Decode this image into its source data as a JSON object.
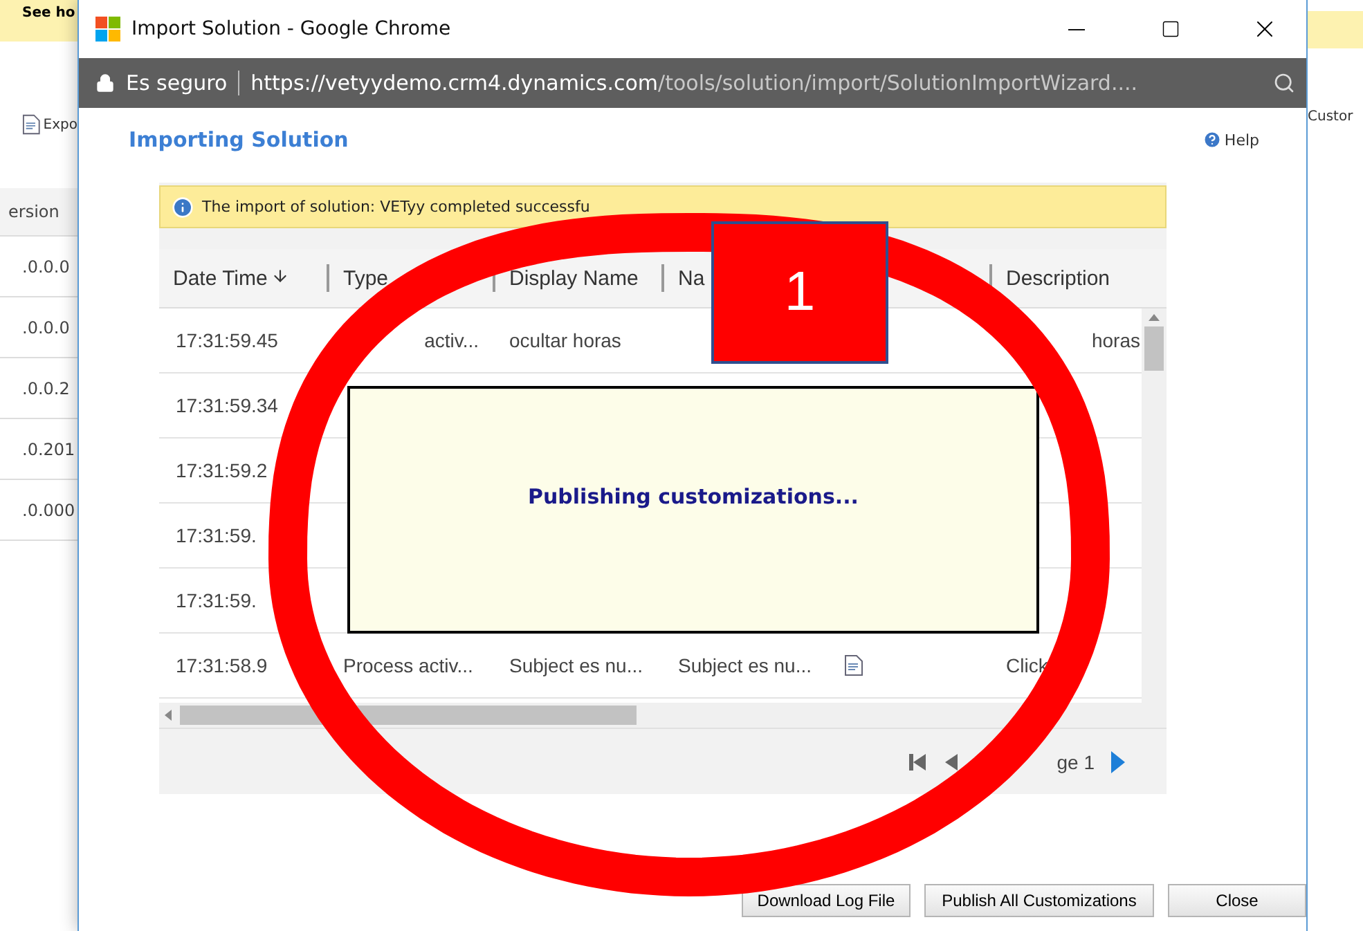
{
  "background": {
    "banner": "See ho",
    "toolbar_left": "Expo",
    "toolbar_right": "Custor",
    "column_header": "ersion",
    "versions": [
      ".0.0.0",
      ".0.0.0",
      ".0.0.2",
      ".0.201",
      ".0.000"
    ]
  },
  "window": {
    "title": "Import Solution - Google Chrome",
    "security": "Es seguro",
    "url_host": "https://vetyydemo.crm4.dynamics.com",
    "url_path": "/tools/solution/import/SolutionImportWizard...."
  },
  "page": {
    "heading": "Importing Solution",
    "help": "Help",
    "notification": "The import of solution: VETyy completed successfu"
  },
  "table": {
    "columns": [
      {
        "label": "Date Time",
        "sorted": true
      },
      {
        "label": "Type",
        "sorted": false
      },
      {
        "label": "Display Name",
        "sorted": false
      },
      {
        "label": "Na"
      },
      {
        "label": "Description",
        "sorted": false
      }
    ],
    "rows": [
      {
        "time": "17:31:59.45",
        "type": "activ...",
        "display_name": "ocultar horas",
        "description": "horas"
      },
      {
        "time": "17:31:59.34"
      },
      {
        "time": "17:31:59.2"
      },
      {
        "time": "17:31:59."
      },
      {
        "time": "17:31:59."
      },
      {
        "time": "17:31:58.9",
        "type": "Process activ...",
        "display_name": "Subject es nu...",
        "name": "Subject es nu...",
        "description": "Click",
        "icon": true
      }
    ]
  },
  "pager": {
    "label": "ge 1"
  },
  "modal": {
    "message": "Publishing customizations..."
  },
  "buttons": [
    "Download Log File",
    "Publish All Customizations",
    "Close"
  ],
  "annotation": {
    "number": "1"
  }
}
